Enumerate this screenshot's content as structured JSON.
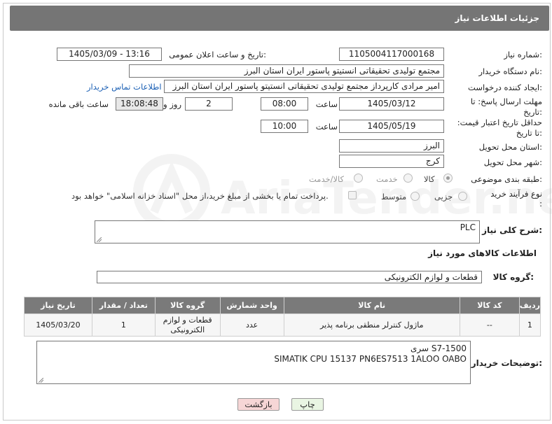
{
  "header": {
    "title": "جزئیات اطلاعات نیاز"
  },
  "form": {
    "need_number_label": "شماره نیاز:",
    "need_number": "1105004117000168",
    "announce_label": "تاریخ و ساعت اعلان عمومی:",
    "announce_value": "1405/03/09 - 13:16",
    "buyer_org_label": "نام دستگاه خریدار:",
    "buyer_org": "مجتمع تولیدی تحقیقاتی انستیتو پاستور ایران استان البرز",
    "requester_label": "ایجاد کننده درخواست:",
    "requester": "امیر مرادی کارپرداز مجتمع تولیدی تحقیقاتی انستیتو پاستور ایران استان البرز",
    "contact_link": "اطلاعات تماس خریدار",
    "deadline_label": "مهلت ارسال پاسخ: تا تاریخ:",
    "deadline_date": "1405/03/12",
    "time_word": "ساعت",
    "deadline_time": "08:00",
    "days_value": "2",
    "days_word": "روز و",
    "remaining_time": "18:08:48",
    "remaining_label": "ساعت باقی مانده",
    "validity_label": "حداقل تاریخ اعتبار قیمت: تا تاریخ:",
    "validity_date": "1405/05/19",
    "validity_time": "10:00",
    "province_label": "استان محل تحویل:",
    "province": "البرز",
    "city_label": "شهر محل تحویل:",
    "city": "کرج",
    "category_label": "طبقه بندی موضوعی:",
    "category_options": [
      "کالا",
      "خدمت",
      "کالا/خدمت"
    ],
    "process_label": "نوع فرآیند خرید :",
    "process_options": [
      "جزیی",
      "متوسط"
    ],
    "payment_note": "پرداخت تمام یا بخشی از مبلغ خرید،از محل \"اسناد خزانه اسلامی\" خواهد بود."
  },
  "description": {
    "label": "شرح کلی نیاز:",
    "value": "PLC"
  },
  "goods": {
    "section_title": "اطلاعات کالاهای مورد نیاز",
    "group_label": "گروه کالا:",
    "group_value": "قطعات و لوازم الکترونیکی",
    "columns": [
      "ردیف",
      "کد کالا",
      "نام کالا",
      "واحد شمارش",
      "گروه کالا",
      "تعداد / مقدار",
      "تاریخ نیاز"
    ],
    "rows": [
      [
        "1",
        "--",
        "ماژول کنترلر منطقی برنامه پذیر",
        "عدد",
        "قطعات و لوازم الکترونیکی",
        "1",
        "1405/03/20"
      ]
    ]
  },
  "buyer_notes": {
    "label": "توضیحات خریدار:",
    "line1": "سری   S7-1500",
    "line2": "SIMATIK CPU 15137 PN6ES7513  1ALOO OABO"
  },
  "buttons": {
    "print": "چاپ",
    "back": "بازگشت"
  },
  "watermark": {
    "text": "AriaTender.neT"
  },
  "colors": {
    "header": "#757575",
    "link": "#1a5fb4",
    "back_button": "#f6d6d6",
    "print_button": "#e9f5e3"
  }
}
